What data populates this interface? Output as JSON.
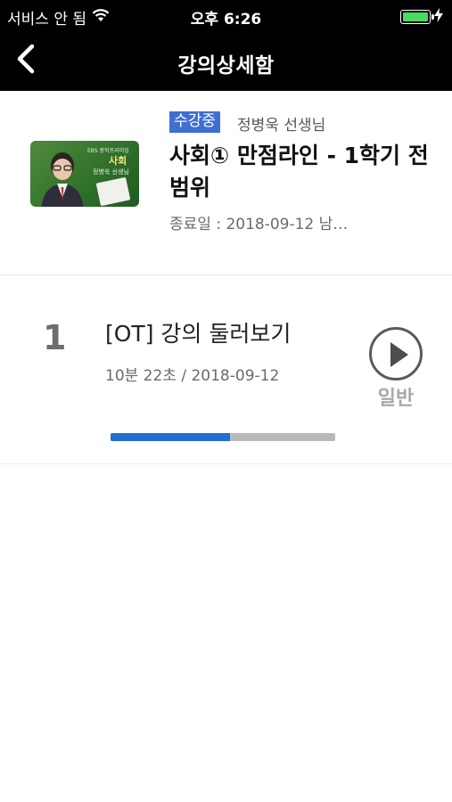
{
  "status_bar": {
    "carrier": "서비스 안 됨",
    "time": "오후 6:26",
    "icons": [
      "wifi-icon",
      "battery-icon",
      "charging-icon"
    ]
  },
  "nav": {
    "title": "강의상세함",
    "back_icon": "chevron-left-icon"
  },
  "course": {
    "badge": "수강중",
    "teacher": "정병욱 선생님",
    "title": "사회① 만점라인 - 1학기 전범위",
    "end_date": "종료일 : 2018-09-12  남…",
    "thumbnail": {
      "brand": "EBS 중학프리미엄",
      "subject": "사회",
      "teacher": "정병욱 선생님"
    }
  },
  "lectures": [
    {
      "number": "1",
      "title": "[OT] 강의 둘러보기",
      "meta": "10분 22초 / 2018-09-12",
      "play_label": "일반",
      "progress": 0.53
    }
  ],
  "colors": {
    "badge": "#3f6fd1",
    "progress_fill": "#1f6fd0",
    "progress_track": "#b9b9b9",
    "bar_background": "#000000"
  }
}
